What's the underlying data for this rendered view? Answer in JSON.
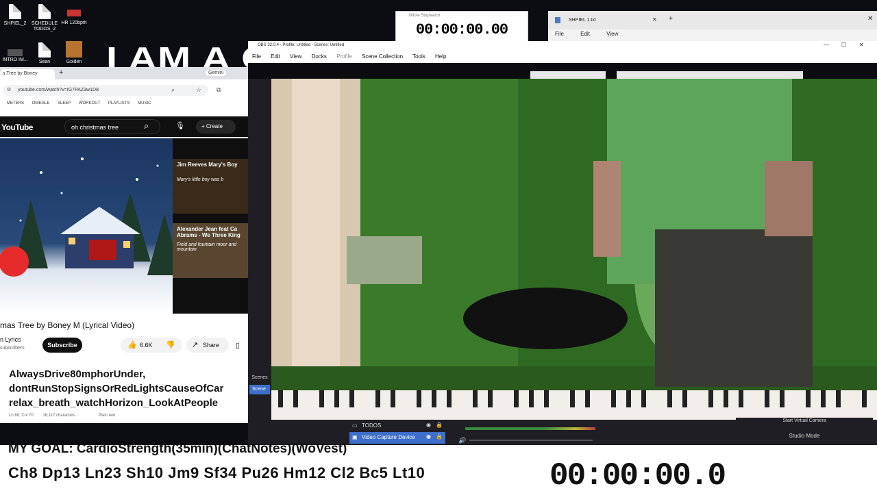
{
  "desktop": {
    "icons": [
      {
        "label": "SHPIEL_2"
      },
      {
        "label": "SCHEDULE TODOS_2"
      },
      {
        "label": "HR 120bpm"
      },
      {
        "label": "INTRO IM..."
      },
      {
        "label": "Sean"
      },
      {
        "label": "Golden"
      }
    ],
    "background_title": "I AM A C"
  },
  "stopwatch": {
    "title": "XNote Stopwatch",
    "time": "00:00:00.00"
  },
  "notepad": {
    "tab": "SHPIEL 1.txt",
    "menu": [
      "File",
      "Edit",
      "View"
    ]
  },
  "browser": {
    "tab_title": "s Tree by Boney",
    "gemini_label": "Gemini",
    "url": "youtube.com/watch?v=IG7PAZ3w1D8",
    "bookmarks": [
      "METERS",
      "OMEGLE",
      "SLEEP",
      "WORKOUT",
      "PLAYLISTS",
      "MUSIC"
    ],
    "youtube": {
      "logo": "YouTube",
      "search_value": "oh christmas tree",
      "create_label": "Create",
      "video_title": "mas Tree by Boney M (Lyrical Video)",
      "channel": "n Lyrics",
      "subscribers": "subscribers",
      "subscribe_label": "Subscribe",
      "likes": "6.6K",
      "share_label": "Share",
      "recommended": [
        {
          "title": "Jim Reeves Mary's Boy",
          "caption": "Mary's little boy was b"
        },
        {
          "title": "Alexander Jean feat Ca Abrams - We Three King",
          "caption": "Field and fountain moor and mountain"
        }
      ]
    }
  },
  "notes": {
    "lines": [
      "AlwaysDrive80mphorUnder,",
      "dontRunStopSignsOrRedLightsCauseOfCar",
      "relax_breath_watchHorizon_LookAtPeople"
    ],
    "status": {
      "position": "Ln 68, Col 70",
      "chars": "16,117 characters",
      "format": "Plain text"
    }
  },
  "obs": {
    "title": "OBS 32.0.4 - Profile: Untitled - Scenes: Untitled",
    "menu": [
      "File",
      "Edit",
      "View",
      "Docks",
      "Profile",
      "Scene Collection",
      "Tools",
      "Help"
    ],
    "scenes_label": "Scenes",
    "scene_item": "Scene",
    "sources": [
      "TODOS",
      "Video Capture Device"
    ],
    "virtual_camera": "Start Virtual Camera",
    "studio_mode": "Studio Mode"
  },
  "overlay": {
    "goal": "MY GOAL: CardioStrength(35min)(ChatNotes)(WoVest)",
    "stats": "Ch8 Dp13 Ln23 Sh10 Jm9 Sf34 Pu26 Hm12 Cl2 Bc5 Lt10",
    "timer": "00:00:00.0"
  },
  "colors": {
    "youtube_red": "#ff0000",
    "obs_bg": "#1e1e24",
    "obs_selected": "#3d6ec9",
    "green_wall": "#2f5e1f"
  }
}
